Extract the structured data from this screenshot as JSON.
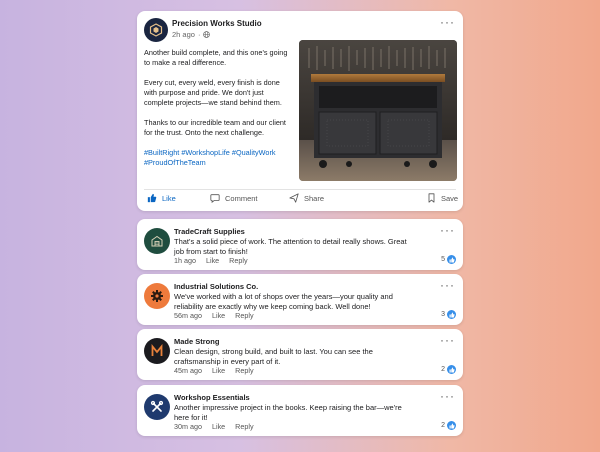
{
  "post": {
    "author": "Precision Works Studio",
    "time": "2h ago",
    "visibility_icon": "globe-icon",
    "paragraphs": [
      "Another build complete, and this one's going to make a real difference.",
      "Every cut, every weld, every finish is done with purpose and pride. We don't just complete projects—we stand behind them.",
      "Thanks to our incredible team and our client for the trust. Onto the next challenge."
    ],
    "hashtags": "#BuiltRight #WorkshopLife #QualityWork #ProudOfTheTeam",
    "actions": {
      "like": "Like",
      "comment": "Comment",
      "share": "Share",
      "save": "Save"
    },
    "more": "···"
  },
  "comments": [
    {
      "author": "TradeCraft Supplies",
      "text": "That's a solid piece of work. The attention to detail really shows. Great job from start to finish!",
      "time": "1h ago",
      "like": "Like",
      "reply": "Reply",
      "count": "5",
      "avatar_color": "#1f4d3f"
    },
    {
      "author": "Industrial Solutions Co.",
      "text": "We've worked with a lot of shops over the years—your quality and reliability are exactly why we keep coming back. Well done!",
      "time": "56m ago",
      "like": "Like",
      "reply": "Reply",
      "count": "3",
      "avatar_color": "#ee7a3c"
    },
    {
      "author": "Made Strong",
      "text": "Clean design, strong build, and built to last. You can see the craftsmanship in every part of it.",
      "time": "45m ago",
      "like": "Like",
      "reply": "Reply",
      "count": "2",
      "avatar_color": "#1b1b1f"
    },
    {
      "author": "Workshop Essentials",
      "text": "Another impressive project in the books. Keep raising the bar—we're here for it!",
      "time": "30m ago",
      "like": "Like",
      "reply": "Reply",
      "count": "2",
      "avatar_color": "#1f3a6e"
    }
  ],
  "colors": {
    "accent": "#0a66c2",
    "reaction": "#378fe9"
  }
}
